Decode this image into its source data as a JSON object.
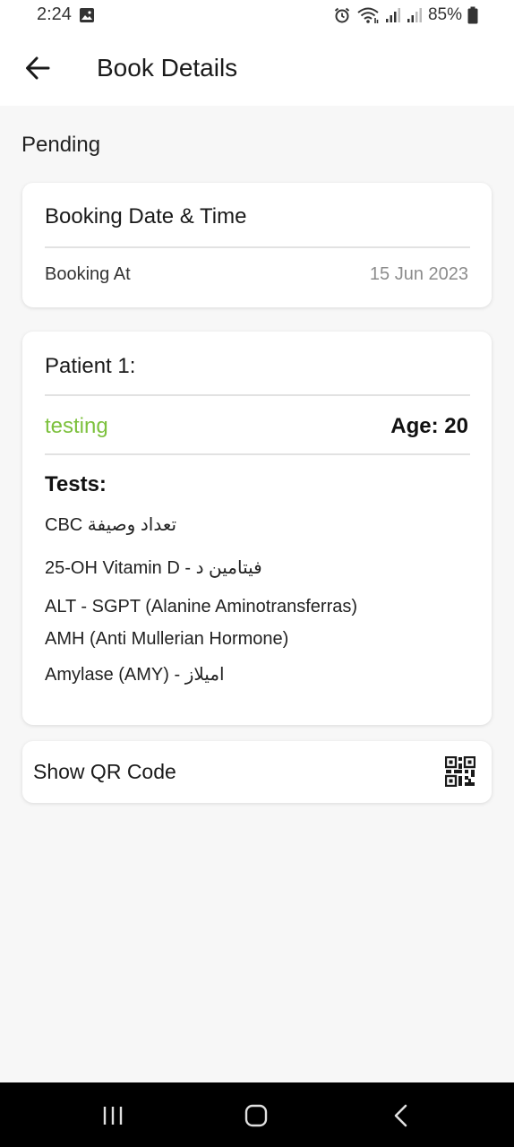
{
  "status_bar": {
    "time": "2:24",
    "battery": "85%",
    "icons": [
      "image-icon",
      "alarm-icon",
      "wifi-icon",
      "signal-icon",
      "signal-icon",
      "battery-icon"
    ]
  },
  "app_bar": {
    "title": "Book Details",
    "back_icon": "arrow-left-icon"
  },
  "booking_status": "Pending",
  "booking_card": {
    "title": "Booking Date & Time",
    "label": "Booking At",
    "value": "15 Jun 2023"
  },
  "patient_card": {
    "title": "Patient 1:",
    "name": "testing",
    "age": "Age: 20",
    "tests_heading": "Tests:",
    "tests": [
      "CBC تعداد وصيفة",
      "25-OH Vitamin D - فيتامين د",
      "ALT - SGPT (Alanine Aminotransferras)",
      "AMH (Anti Mullerian Hormone)",
      "Amylase (AMY) - اميلاز"
    ]
  },
  "qr_card": {
    "label": "Show QR Code",
    "icon": "qr-code-icon"
  },
  "nav_bar": {
    "icons": [
      "recent-apps-icon",
      "home-icon",
      "back-icon"
    ]
  },
  "colors": {
    "accent_green": "#7dc13e",
    "background": "#f7f7f7",
    "card": "#ffffff",
    "muted_text": "#8c8c8c"
  }
}
